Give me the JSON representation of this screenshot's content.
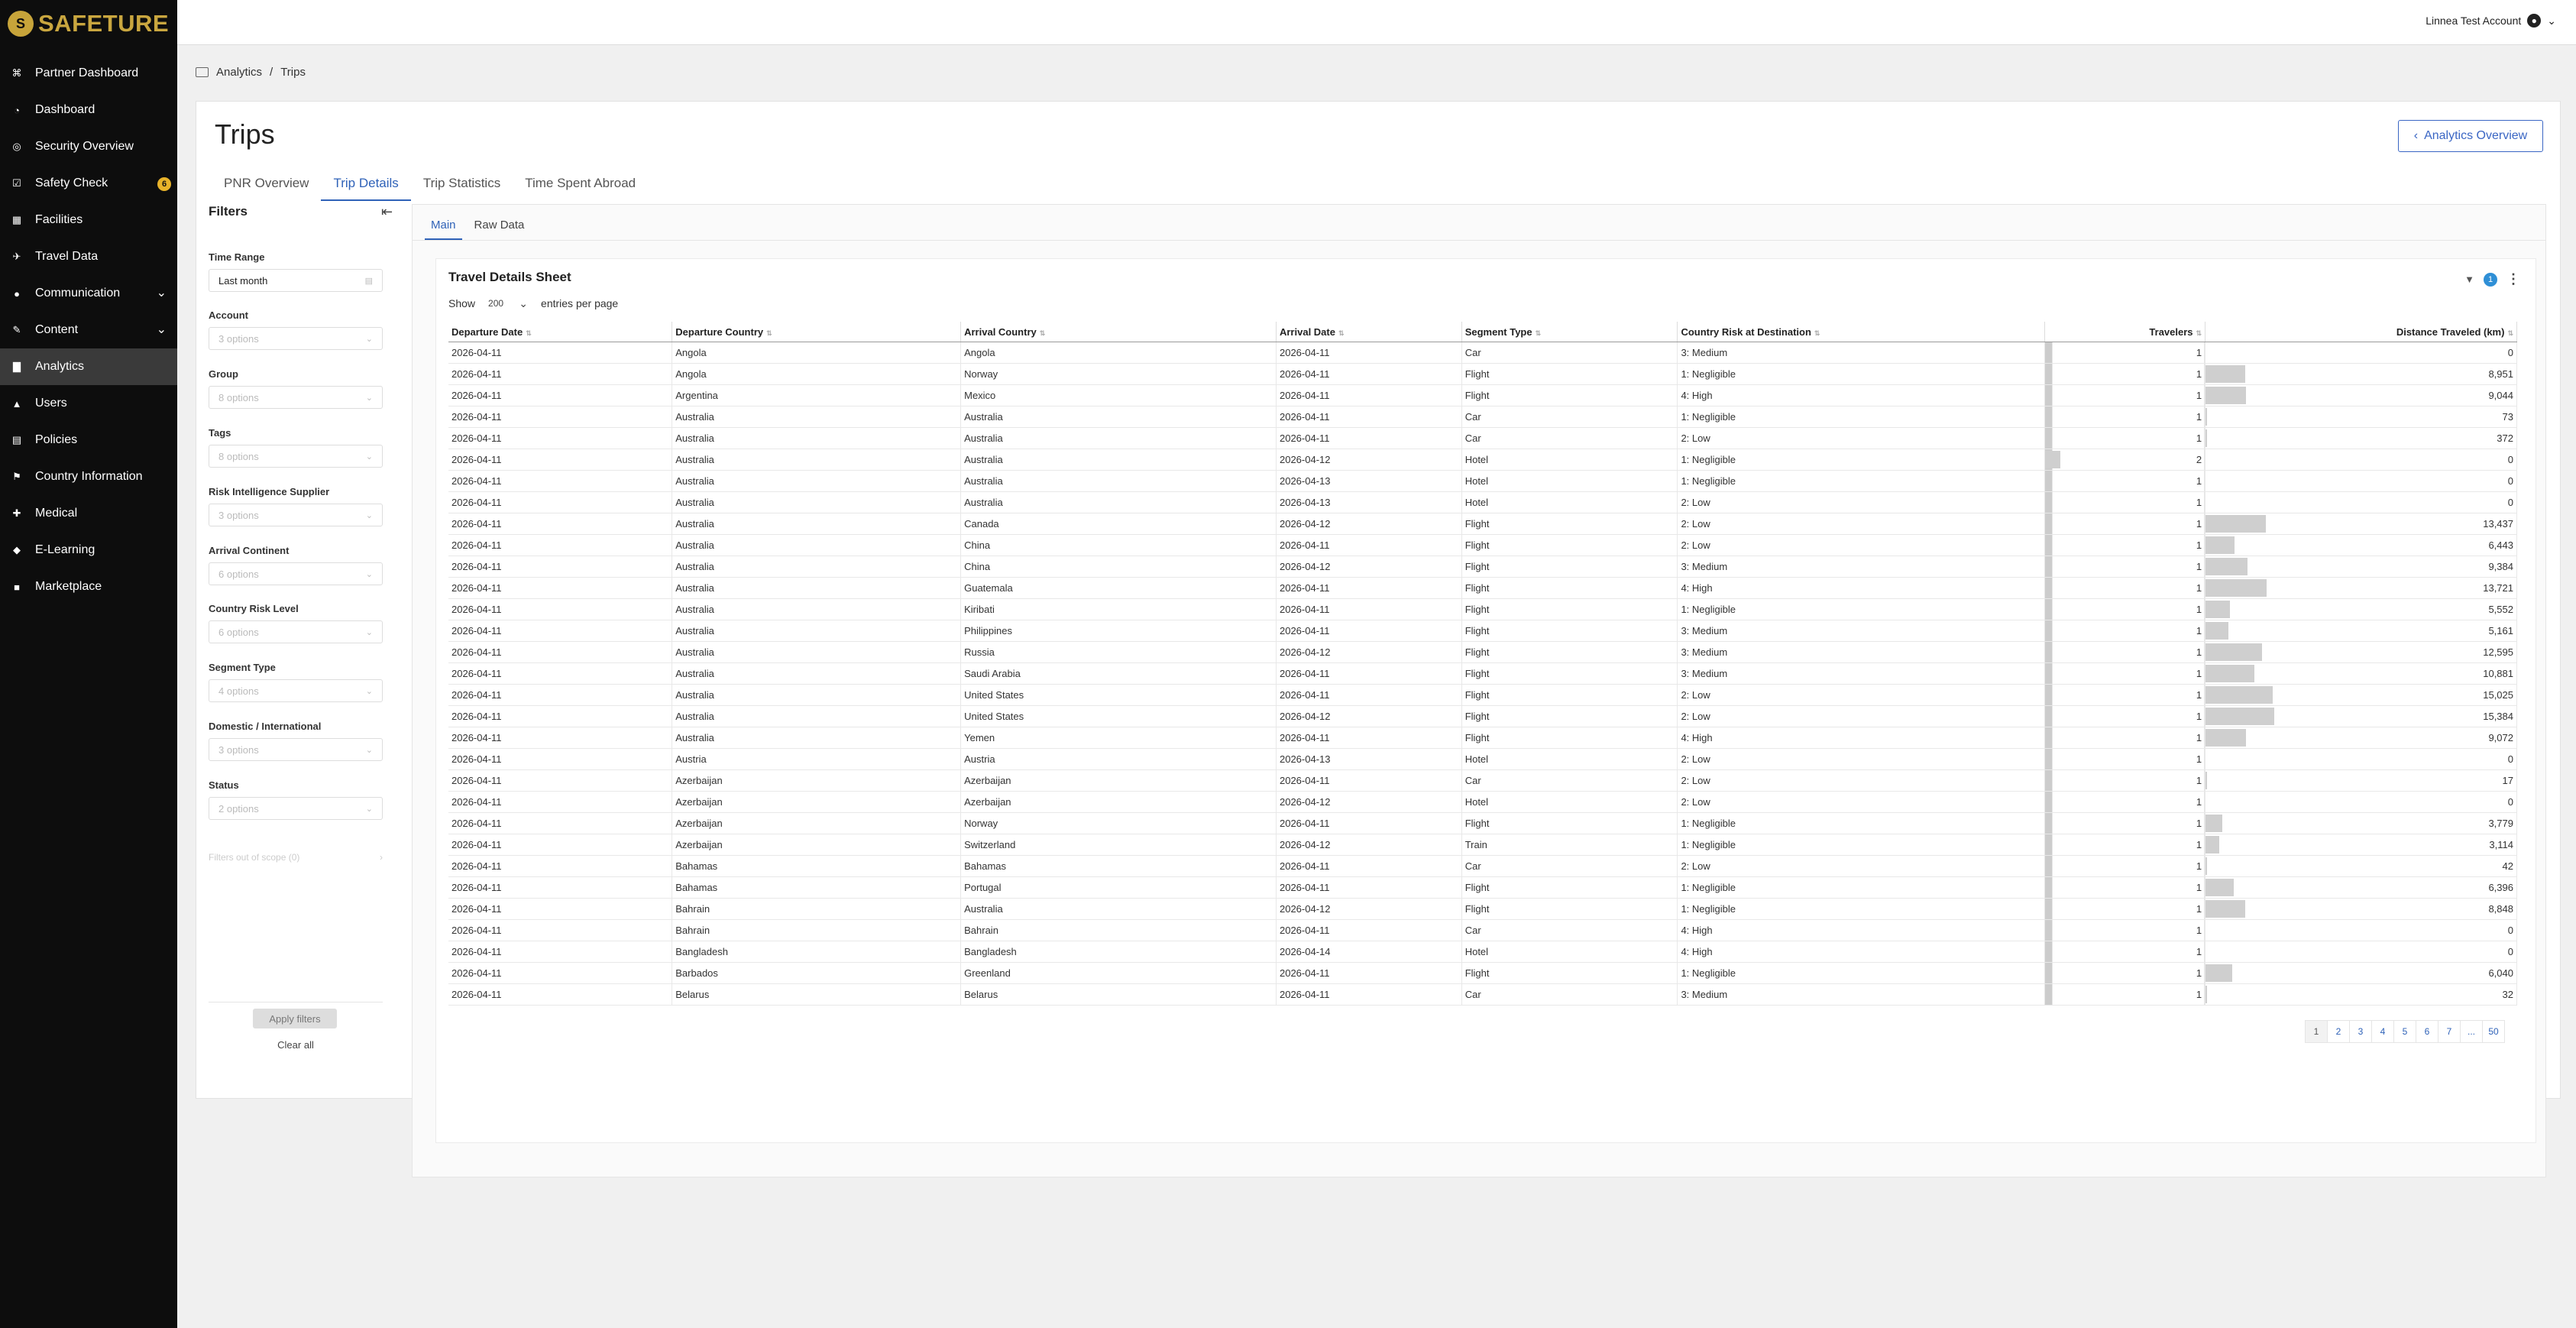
{
  "brand": {
    "logo_text": "SAFETURE",
    "logo_mark": "S"
  },
  "account": {
    "name": "Linnea Test Account"
  },
  "sidebar": {
    "items": [
      {
        "label": "Partner Dashboard",
        "icon": "partner-icon"
      },
      {
        "label": "Dashboard",
        "icon": "dashboard-icon"
      },
      {
        "label": "Security Overview",
        "icon": "globe-icon"
      },
      {
        "label": "Safety Check",
        "icon": "check-icon",
        "badge": "6"
      },
      {
        "label": "Facilities",
        "icon": "building-icon"
      },
      {
        "label": "Travel Data",
        "icon": "plane-icon"
      },
      {
        "label": "Communication",
        "icon": "chat-icon",
        "expandable": true
      },
      {
        "label": "Content",
        "icon": "pen-icon",
        "expandable": true
      },
      {
        "label": "Analytics",
        "icon": "chart-icon",
        "active": true
      },
      {
        "label": "Users",
        "icon": "user-icon"
      },
      {
        "label": "Policies",
        "icon": "document-icon"
      },
      {
        "label": "Country Information",
        "icon": "flag-icon"
      },
      {
        "label": "Medical",
        "icon": "medical-icon"
      },
      {
        "label": "E-Learning",
        "icon": "graduation-icon"
      },
      {
        "label": "Marketplace",
        "icon": "cart-icon"
      }
    ]
  },
  "breadcrumb": {
    "root": "Analytics",
    "separator": "/",
    "current": "Trips"
  },
  "page": {
    "title": "Trips",
    "overview_button": "Analytics Overview"
  },
  "tabs": [
    "PNR Overview",
    "Trip Details",
    "Trip Statistics",
    "Time Spent Abroad"
  ],
  "active_tab": "Trip Details",
  "filters": {
    "title": "Filters",
    "groups": [
      {
        "label": "Time Range",
        "value": "Last month",
        "filled": true
      },
      {
        "label": "Account",
        "value": "3 options"
      },
      {
        "label": "Group",
        "value": "8 options"
      },
      {
        "label": "Tags",
        "value": "8 options"
      },
      {
        "label": "Risk Intelligence Supplier",
        "value": "3 options"
      },
      {
        "label": "Arrival Continent",
        "value": "6 options"
      },
      {
        "label": "Country Risk Level",
        "value": "6 options"
      },
      {
        "label": "Segment Type",
        "value": "4 options"
      },
      {
        "label": "Domestic / International",
        "value": "3 options"
      },
      {
        "label": "Status",
        "value": "2 options"
      }
    ],
    "scope_text": "Filters out of scope (0)",
    "apply_label": "Apply filters",
    "clear_label": "Clear all"
  },
  "subtabs": [
    "Main",
    "Raw Data"
  ],
  "sheet": {
    "title": "Travel Details Sheet",
    "filter_count": "1",
    "show_label": "Show",
    "entries_value": "200",
    "entries_label": "entries per page",
    "columns": [
      "Departure Date",
      "Departure Country",
      "Arrival Country",
      "Arrival Date",
      "Segment Type",
      "Country Risk at Destination",
      "Travelers",
      "Distance Traveled (km)"
    ],
    "rows": [
      [
        "2026-04-11",
        "Angola",
        "Angola",
        "2026-04-11",
        "Car",
        "3: Medium",
        "1",
        "0"
      ],
      [
        "2026-04-11",
        "Angola",
        "Norway",
        "2026-04-11",
        "Flight",
        "1: Negligible",
        "1",
        "8,951"
      ],
      [
        "2026-04-11",
        "Argentina",
        "Mexico",
        "2026-04-11",
        "Flight",
        "4: High",
        "1",
        "9,044"
      ],
      [
        "2026-04-11",
        "Australia",
        "Australia",
        "2026-04-11",
        "Car",
        "1: Negligible",
        "1",
        "73"
      ],
      [
        "2026-04-11",
        "Australia",
        "Australia",
        "2026-04-11",
        "Car",
        "2: Low",
        "1",
        "372"
      ],
      [
        "2026-04-11",
        "Australia",
        "Australia",
        "2026-04-12",
        "Hotel",
        "1: Negligible",
        "2",
        "0"
      ],
      [
        "2026-04-11",
        "Australia",
        "Australia",
        "2026-04-13",
        "Hotel",
        "1: Negligible",
        "1",
        "0"
      ],
      [
        "2026-04-11",
        "Australia",
        "Australia",
        "2026-04-13",
        "Hotel",
        "2: Low",
        "1",
        "0"
      ],
      [
        "2026-04-11",
        "Australia",
        "Canada",
        "2026-04-12",
        "Flight",
        "2: Low",
        "1",
        "13,437"
      ],
      [
        "2026-04-11",
        "Australia",
        "China",
        "2026-04-11",
        "Flight",
        "2: Low",
        "1",
        "6,443"
      ],
      [
        "2026-04-11",
        "Australia",
        "China",
        "2026-04-12",
        "Flight",
        "3: Medium",
        "1",
        "9,384"
      ],
      [
        "2026-04-11",
        "Australia",
        "Guatemala",
        "2026-04-11",
        "Flight",
        "4: High",
        "1",
        "13,721"
      ],
      [
        "2026-04-11",
        "Australia",
        "Kiribati",
        "2026-04-11",
        "Flight",
        "1: Negligible",
        "1",
        "5,552"
      ],
      [
        "2026-04-11",
        "Australia",
        "Philippines",
        "2026-04-11",
        "Flight",
        "3: Medium",
        "1",
        "5,161"
      ],
      [
        "2026-04-11",
        "Australia",
        "Russia",
        "2026-04-12",
        "Flight",
        "3: Medium",
        "1",
        "12,595"
      ],
      [
        "2026-04-11",
        "Australia",
        "Saudi Arabia",
        "2026-04-11",
        "Flight",
        "3: Medium",
        "1",
        "10,881"
      ],
      [
        "2026-04-11",
        "Australia",
        "United States",
        "2026-04-11",
        "Flight",
        "2: Low",
        "1",
        "15,025"
      ],
      [
        "2026-04-11",
        "Australia",
        "United States",
        "2026-04-12",
        "Flight",
        "2: Low",
        "1",
        "15,384"
      ],
      [
        "2026-04-11",
        "Australia",
        "Yemen",
        "2026-04-11",
        "Flight",
        "4: High",
        "1",
        "9,072"
      ],
      [
        "2026-04-11",
        "Austria",
        "Austria",
        "2026-04-13",
        "Hotel",
        "2: Low",
        "1",
        "0"
      ],
      [
        "2026-04-11",
        "Azerbaijan",
        "Azerbaijan",
        "2026-04-11",
        "Car",
        "2: Low",
        "1",
        "17"
      ],
      [
        "2026-04-11",
        "Azerbaijan",
        "Azerbaijan",
        "2026-04-12",
        "Hotel",
        "2: Low",
        "1",
        "0"
      ],
      [
        "2026-04-11",
        "Azerbaijan",
        "Norway",
        "2026-04-11",
        "Flight",
        "1: Negligible",
        "1",
        "3,779"
      ],
      [
        "2026-04-11",
        "Azerbaijan",
        "Switzerland",
        "2026-04-12",
        "Train",
        "1: Negligible",
        "1",
        "3,114"
      ],
      [
        "2026-04-11",
        "Bahamas",
        "Bahamas",
        "2026-04-11",
        "Car",
        "2: Low",
        "1",
        "42"
      ],
      [
        "2026-04-11",
        "Bahamas",
        "Portugal",
        "2026-04-11",
        "Flight",
        "1: Negligible",
        "1",
        "6,396"
      ],
      [
        "2026-04-11",
        "Bahrain",
        "Australia",
        "2026-04-12",
        "Flight",
        "1: Negligible",
        "1",
        "8,848"
      ],
      [
        "2026-04-11",
        "Bahrain",
        "Bahrain",
        "2026-04-11",
        "Car",
        "4: High",
        "1",
        "0"
      ],
      [
        "2026-04-11",
        "Bangladesh",
        "Bangladesh",
        "2026-04-14",
        "Hotel",
        "4: High",
        "1",
        "0"
      ],
      [
        "2026-04-11",
        "Barbados",
        "Greenland",
        "2026-04-11",
        "Flight",
        "1: Negligible",
        "1",
        "6,040"
      ],
      [
        "2026-04-11",
        "Belarus",
        "Belarus",
        "2026-04-11",
        "Car",
        "3: Medium",
        "1",
        "32"
      ]
    ],
    "pages": [
      "1",
      "2",
      "3",
      "4",
      "5",
      "6",
      "7",
      "...",
      "50"
    ],
    "current_page": "1"
  },
  "colors": {
    "accent": "#2f62b8",
    "sidebar_bg": "#0d0d0d",
    "brand_gold": "#c9a63f",
    "badge": "#e8b32a",
    "bar": "#cfcfcf"
  }
}
